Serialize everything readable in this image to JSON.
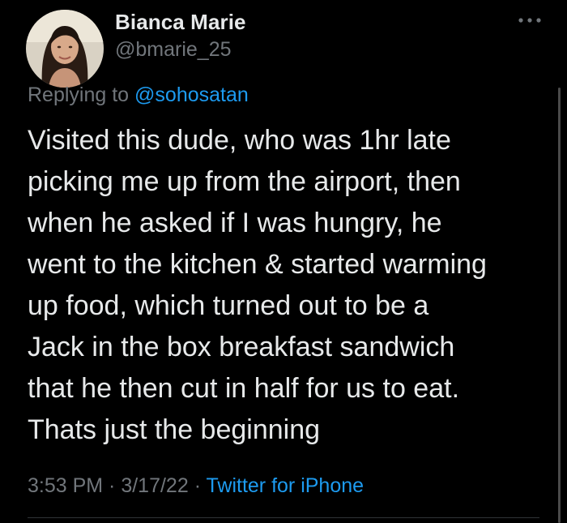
{
  "author": {
    "display_name": "Bianca Marie",
    "handle": "@bmarie_25"
  },
  "reply_context": {
    "prefix": "Replying to ",
    "mention": "@sohosatan"
  },
  "tweet": {
    "lines": [
      "Visited this dude, who was 1hr late",
      "picking me up from the airport, then",
      "when he asked if I was hungry, he",
      "went to the kitchen & started warming",
      "up food, which turned out to be a",
      "Jack in the box breakfast sandwich",
      "that he then cut in half for us to eat.",
      "Thats just the beginning"
    ]
  },
  "meta": {
    "time": "3:53 PM",
    "separator_1": " · ",
    "date": "3/17/22",
    "separator_2": " · ",
    "source": "Twitter for iPhone"
  },
  "icons": {
    "more": "more-horizontal-icon",
    "avatar": "profile-photo"
  },
  "colors": {
    "background": "#000000",
    "primary_text": "#e7e9ea",
    "secondary_text": "#71767b",
    "link": "#1d9bf0",
    "divider": "#2f3336"
  }
}
